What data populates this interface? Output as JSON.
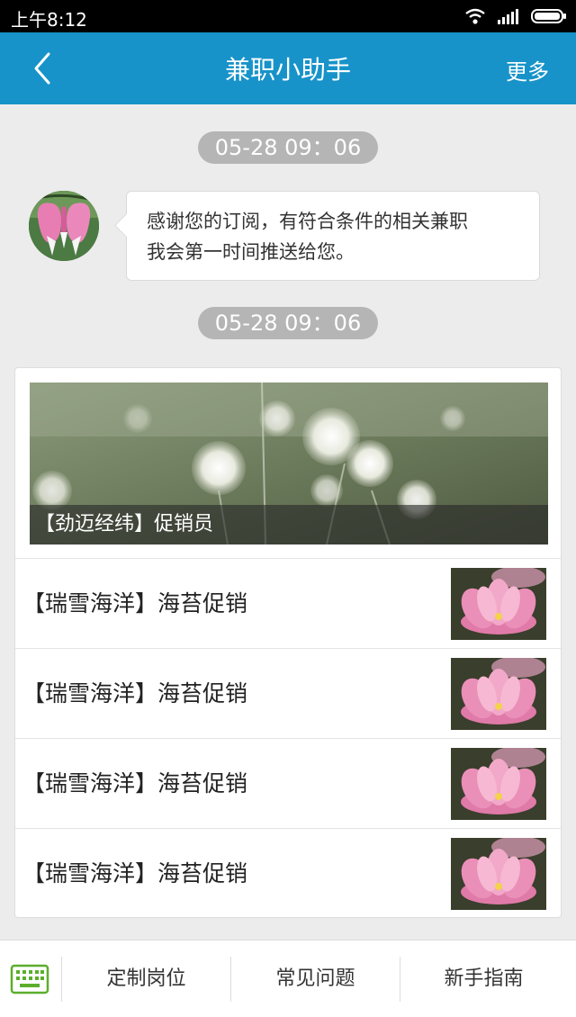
{
  "status_bar": {
    "time": "上午8:12",
    "icons": [
      "wifi-icon",
      "signal-icon",
      "battery-icon"
    ]
  },
  "nav": {
    "back_icon": "chevron-left-icon",
    "title": "兼职小助手",
    "more": "更多"
  },
  "messages": [
    {
      "timestamp": "05-28 09：06",
      "type": "text",
      "text_line1": "感谢您的订阅，有符合条件的相关兼职",
      "text_line2": "我会第一时间推送给您。"
    },
    {
      "timestamp": "05-28 09：06",
      "type": "job_card",
      "banner_title": "【劲迈经纬】促销员",
      "items": [
        {
          "title": "【瑞雪海洋】海苔促销"
        },
        {
          "title": "【瑞雪海洋】海苔促销"
        },
        {
          "title": "【瑞雪海洋】海苔促销"
        },
        {
          "title": "【瑞雪海洋】海苔促销"
        }
      ]
    }
  ],
  "bottom_bar": {
    "keyboard_icon": "keyboard-icon",
    "tabs": [
      "定制岗位",
      "常见问题",
      "新手指南"
    ]
  },
  "colors": {
    "nav_bg": "#1793c9",
    "page_bg": "#ececec",
    "timestamp_pill": "#b5b5b5",
    "keyboard_icon": "#5cae2c"
  }
}
